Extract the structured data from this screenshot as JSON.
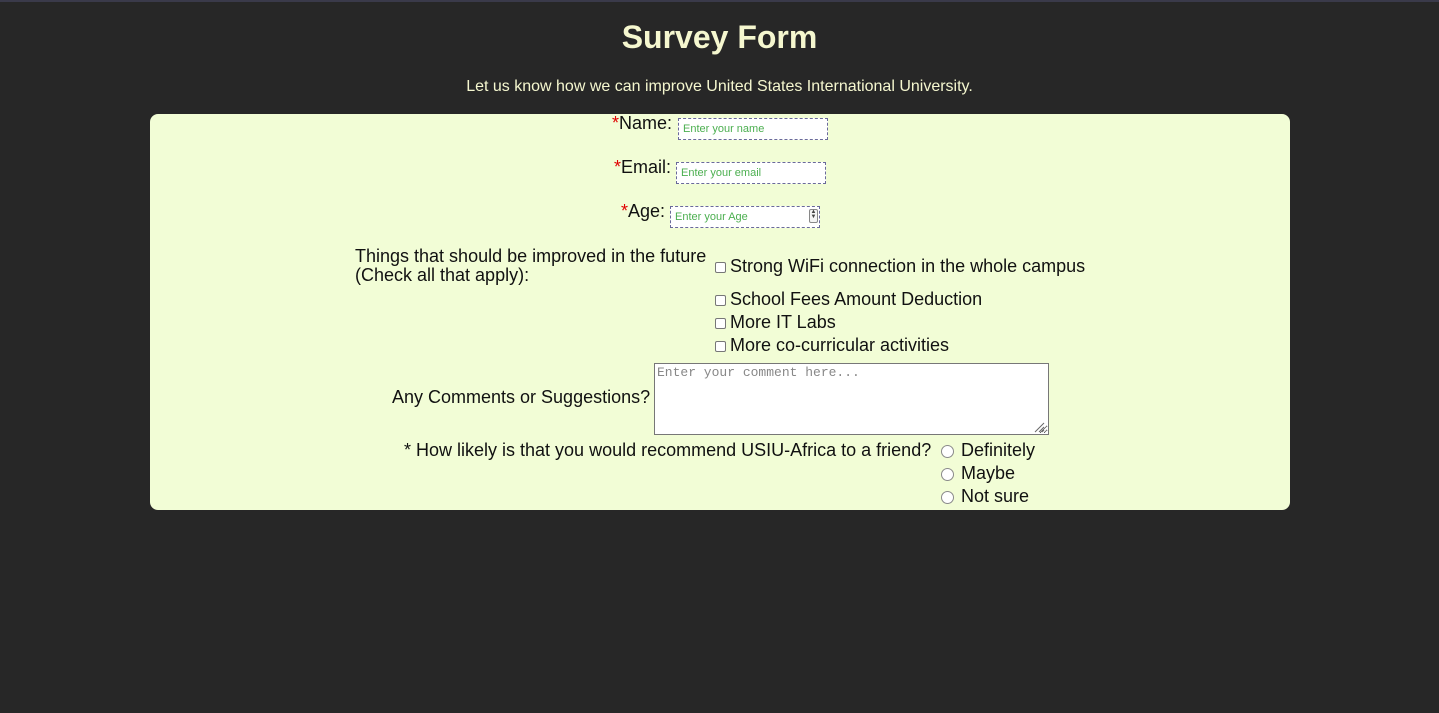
{
  "page": {
    "title": "Survey Form",
    "description": "Let us know how we can improve United States International University."
  },
  "form": {
    "required_marker": "*",
    "name": {
      "label": "Name:",
      "placeholder": "Enter your name",
      "value": ""
    },
    "email": {
      "label": "Email:",
      "placeholder": "Enter your email",
      "value": ""
    },
    "age": {
      "label": "Age:",
      "placeholder": "Enter your Age",
      "value": ""
    },
    "improvements": {
      "label_line1": "Things that should be improved in the future",
      "label_line2": "(Check all that apply):",
      "options": [
        {
          "label": "Strong WiFi connection in the whole campus",
          "checked": false
        },
        {
          "label": "School Fees Amount Deduction",
          "checked": false
        },
        {
          "label": "More IT Labs",
          "checked": false
        },
        {
          "label": "More co-curricular activities",
          "checked": false
        }
      ]
    },
    "comments": {
      "label": "Any Comments or Suggestions?",
      "placeholder": "Enter your comment here...",
      "value": ""
    },
    "recommend": {
      "label": "* How likely is that you would recommend USIU-Africa to a friend?",
      "options": [
        {
          "label": "Definitely",
          "selected": false
        },
        {
          "label": "Maybe",
          "selected": false
        },
        {
          "label": "Not sure",
          "selected": false
        }
      ]
    }
  },
  "colors": {
    "page_background": "#272727",
    "card_background": "#f2fdd6",
    "heading_text": "#f5f7cf",
    "required_marker": "#e00000",
    "placeholder_text": "#4caf50"
  }
}
